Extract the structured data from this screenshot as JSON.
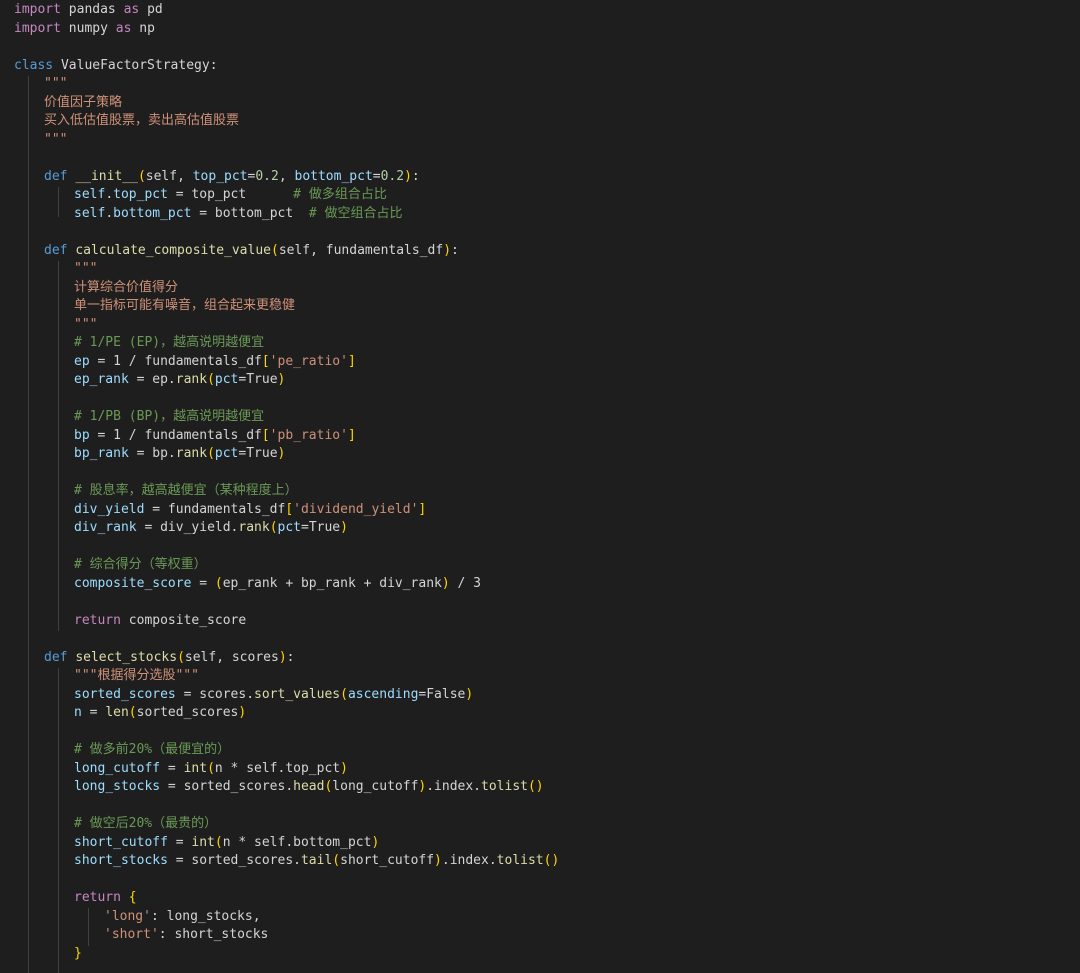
{
  "colors": {
    "background": "#1e1e1e",
    "keyword": "#c586c0",
    "function": "#dcdcaa",
    "variable": "#9cdcfe",
    "string": "#ce9178",
    "comment": "#6a9955",
    "number": "#b5cea8",
    "bracket": "#ffd700"
  },
  "code": {
    "l1": [
      "import",
      " pandas ",
      "as",
      " pd"
    ],
    "l2": [
      "import",
      " numpy ",
      "as",
      " np"
    ],
    "l4": [
      "class",
      " ",
      "ValueFactorStrategy",
      ":"
    ],
    "l5": "\"\"\"",
    "l6": "价值因子策略",
    "l7": "买入低估值股票，卖出高估值股票",
    "l8": "\"\"\"",
    "l10": [
      "def",
      " ",
      "__init__",
      "(",
      "self",
      ", ",
      "top_pct",
      "=",
      "0.2",
      ", ",
      "bottom_pct",
      "=",
      "0.2",
      ")",
      ":"
    ],
    "l11": [
      "self",
      ".",
      "top_pct",
      " = top_pct      ",
      "# 做多组合占比"
    ],
    "l12": [
      "self",
      ".",
      "bottom_pct",
      " = bottom_pct  ",
      "# 做空组合占比"
    ],
    "l14": [
      "def",
      " ",
      "calculate_composite_value",
      "(",
      "self",
      ", fundamentals_df",
      ")",
      ":"
    ],
    "l15": "\"\"\"",
    "l16": "计算综合价值得分",
    "l17": "单一指标可能有噪音，组合起来更稳健",
    "l18": "\"\"\"",
    "l19": "# 1/PE (EP)，越高说明越便宜",
    "l20": [
      "ep",
      " = 1 / fundamentals_df",
      "[",
      "'pe_ratio'",
      "]"
    ],
    "l21": [
      "ep_rank",
      " = ep.",
      "rank",
      "(",
      "pct",
      "=True",
      ")"
    ],
    "l23": "# 1/PB (BP)，越高说明越便宜",
    "l24": [
      "bp",
      " = 1 / fundamentals_df",
      "[",
      "'pb_ratio'",
      "]"
    ],
    "l25": [
      "bp_rank",
      " = bp.",
      "rank",
      "(",
      "pct",
      "=True",
      ")"
    ],
    "l27": "# 股息率，越高越便宜（某种程度上）",
    "l28": [
      "div_yield",
      " = fundamentals_df",
      "[",
      "'dividend_yield'",
      "]"
    ],
    "l29": [
      "div_rank",
      " = div_yield.",
      "rank",
      "(",
      "pct",
      "=True",
      ")"
    ],
    "l31": "# 综合得分（等权重）",
    "l32": [
      "composite_score",
      " = ",
      "(",
      "ep_rank + bp_rank + div_rank",
      ")",
      " / 3"
    ],
    "l34": [
      "return",
      " composite_score"
    ],
    "l36": [
      "def",
      " ",
      "select_stocks",
      "(",
      "self",
      ", scores",
      ")",
      ":"
    ],
    "l37": "\"\"\"根据得分选股\"\"\"",
    "l38": [
      "sorted_scores",
      " = scores.",
      "sort_values",
      "(",
      "ascending",
      "=False",
      ")"
    ],
    "l39": [
      "n",
      " = ",
      "len",
      "(",
      "sorted_scores",
      ")"
    ],
    "l41": "# 做多前20%（最便宜的）",
    "l42": [
      "long_cutoff",
      " = ",
      "int",
      "(",
      "n * self.top_pct",
      ")"
    ],
    "l43": [
      "long_stocks",
      " = sorted_scores.",
      "head",
      "(",
      "long_cutoff",
      ")",
      ".index.",
      "tolist",
      "()"
    ],
    "l45": "# 做空后20%（最贵的）",
    "l46": [
      "short_cutoff",
      " = ",
      "int",
      "(",
      "n * self.bottom_pct",
      ")"
    ],
    "l47": [
      "short_stocks",
      " = sorted_scores.",
      "tail",
      "(",
      "short_cutoff",
      ")",
      ".index.",
      "tolist",
      "()"
    ],
    "l49": [
      "return",
      " ",
      "{"
    ],
    "l50": [
      "'long'",
      ": long_stocks,"
    ],
    "l51": [
      "'short'",
      ": short_stocks"
    ],
    "l52": "}"
  }
}
